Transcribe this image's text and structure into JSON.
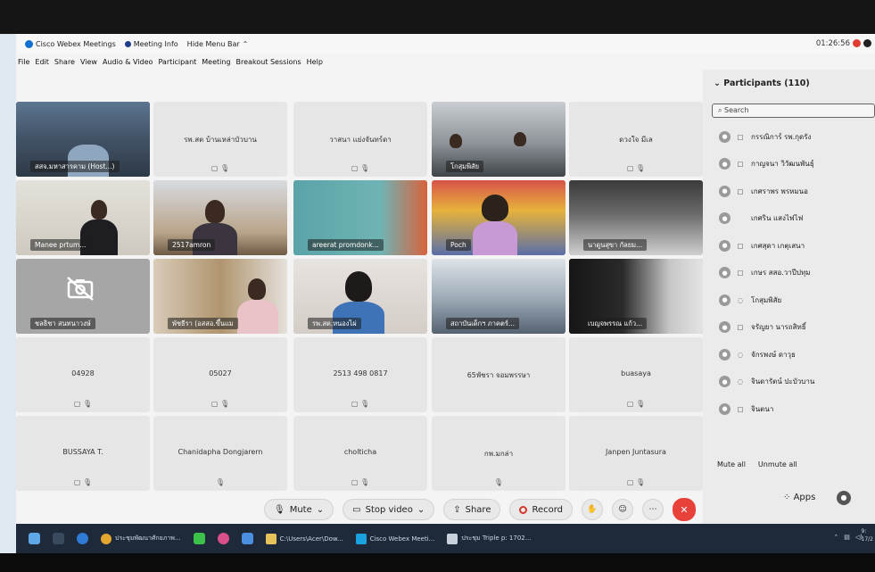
{
  "topbar": {
    "app_name": "Cisco Webex Meetings",
    "meeting_info": "Meeting Info",
    "hide_menu": "Hide Menu Bar",
    "clock": "01:26:56"
  },
  "menu": [
    "File",
    "Edit",
    "Share",
    "View",
    "Audio & Video",
    "Participant",
    "Meeting",
    "Breakout Sessions",
    "Help"
  ],
  "tiles": [
    {
      "label": "สสจ.มหาสารคาม (Host...)",
      "kind": "video"
    },
    {
      "label": "รพ.สต บ้านเหล่าบัวบาน",
      "kind": "name",
      "icons": "▢ 🎙"
    },
    {
      "label": "วาสนา แย่งจันทร์ดา",
      "kind": "name",
      "icons": "▢ 🎙"
    },
    {
      "label": "โกสุมพิสัย",
      "kind": "video"
    },
    {
      "label": "ดวงใจ มีเล",
      "kind": "name",
      "icons": "▢ 🎙"
    },
    {
      "label": "Manee prtum...",
      "kind": "video"
    },
    {
      "label": "2517amron",
      "kind": "video"
    },
    {
      "label": "areerat promdonk...",
      "kind": "video"
    },
    {
      "label": "Poch",
      "kind": "video"
    },
    {
      "label": "นาดูนสุขา กัลยม...",
      "kind": "video"
    },
    {
      "label": "ชลธิชา สนทนาวงษ์",
      "kind": "camoff"
    },
    {
      "label": "พัชธีรา (อสสอ.ขึ้นแม",
      "kind": "video"
    },
    {
      "label": "รพ.สต.หนองไผ่",
      "kind": "video"
    },
    {
      "label": "สถาบันเด็กฯ ภาคตร์...",
      "kind": "video"
    },
    {
      "label": "เบญจพรรณ แก้ว...",
      "kind": "video"
    },
    {
      "label": "04928",
      "kind": "name",
      "icons": "▢ 🎙"
    },
    {
      "label": "05027",
      "kind": "name",
      "icons": "▢ 🎙"
    },
    {
      "label": "2513 498 0817",
      "kind": "name",
      "icons": "▢ 🎙"
    },
    {
      "label": "65พัชรา จอมพรรษา",
      "kind": "name",
      "icons": ""
    },
    {
      "label": "buasaya",
      "kind": "name",
      "icons": "▢ 🎙"
    },
    {
      "label": "BUSSAYA T.",
      "kind": "name",
      "icons": "▢ 🎙"
    },
    {
      "label": "Chanidapha Dongjarern",
      "kind": "name",
      "icons": "🎙"
    },
    {
      "label": "cholticha",
      "kind": "name",
      "icons": "▢ 🎙"
    },
    {
      "label": "กพ.มกล่า",
      "kind": "name",
      "icons": "🎙"
    },
    {
      "label": "Janpen Juntasura",
      "kind": "name",
      "icons": "▢ 🎙"
    }
  ],
  "panel": {
    "title": "Participants (110)",
    "search_placeholder": "Search",
    "participants": [
      {
        "name": "กรรณิการ์ รพ.กุดรัง",
        "device": "▢"
      },
      {
        "name": "กาญจนา วิวัฒนพันธุ์",
        "device": "▢"
      },
      {
        "name": "เกศราพร พรหมนอ",
        "device": "▢"
      },
      {
        "name": "เกศริน แสงไฟไฟ",
        "device": ""
      },
      {
        "name": "เกศสุดา เกตุเสนา",
        "device": "▢"
      },
      {
        "name": "เกษร สสอ.วาปีปทุม",
        "device": "▢"
      },
      {
        "name": "โกสุมพิสัย",
        "device": "◌"
      },
      {
        "name": "จรัญยา นารถสิทธิ์",
        "device": "▢"
      },
      {
        "name": "จักรพงษ์ ดาวุธ",
        "device": "◌"
      },
      {
        "name": "จินดารัตน์ ปะบัวบาน",
        "device": "◌"
      },
      {
        "name": "จินตนา",
        "device": "▢"
      }
    ],
    "mute_all": "Mute all",
    "unmute_all": "Unmute all",
    "apps": "Apps"
  },
  "controls": {
    "mute": "Mute",
    "stop_video": "Stop video",
    "share": "Share",
    "record": "Record"
  },
  "taskbar": {
    "apps": [
      "ประชุมพัฒนาศักยภาพ...",
      "C:\\Users\\Acer\\Dow...",
      "Cisco Webex Meeti...",
      "ประชุม Triple p: 1702..."
    ],
    "time": "9:",
    "date": "17/2"
  },
  "colors": {
    "accent": "#1170cf",
    "end_call": "#e8413a",
    "taskbar": "#1e2a3a"
  }
}
